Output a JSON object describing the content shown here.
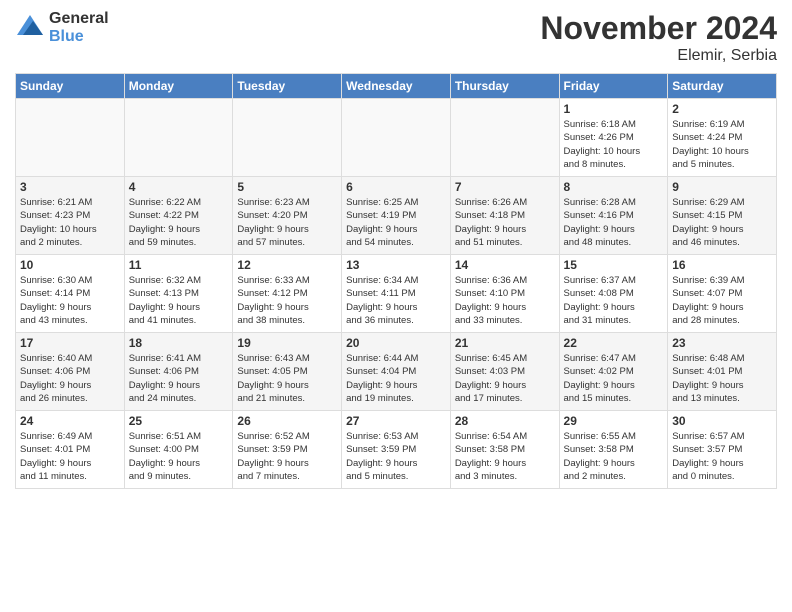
{
  "header": {
    "logo_general": "General",
    "logo_blue": "Blue",
    "month_title": "November 2024",
    "location": "Elemir, Serbia"
  },
  "weekdays": [
    "Sunday",
    "Monday",
    "Tuesday",
    "Wednesday",
    "Thursday",
    "Friday",
    "Saturday"
  ],
  "weeks": [
    [
      {
        "day": "",
        "info": ""
      },
      {
        "day": "",
        "info": ""
      },
      {
        "day": "",
        "info": ""
      },
      {
        "day": "",
        "info": ""
      },
      {
        "day": "",
        "info": ""
      },
      {
        "day": "1",
        "info": "Sunrise: 6:18 AM\nSunset: 4:26 PM\nDaylight: 10 hours\nand 8 minutes."
      },
      {
        "day": "2",
        "info": "Sunrise: 6:19 AM\nSunset: 4:24 PM\nDaylight: 10 hours\nand 5 minutes."
      }
    ],
    [
      {
        "day": "3",
        "info": "Sunrise: 6:21 AM\nSunset: 4:23 PM\nDaylight: 10 hours\nand 2 minutes."
      },
      {
        "day": "4",
        "info": "Sunrise: 6:22 AM\nSunset: 4:22 PM\nDaylight: 9 hours\nand 59 minutes."
      },
      {
        "day": "5",
        "info": "Sunrise: 6:23 AM\nSunset: 4:20 PM\nDaylight: 9 hours\nand 57 minutes."
      },
      {
        "day": "6",
        "info": "Sunrise: 6:25 AM\nSunset: 4:19 PM\nDaylight: 9 hours\nand 54 minutes."
      },
      {
        "day": "7",
        "info": "Sunrise: 6:26 AM\nSunset: 4:18 PM\nDaylight: 9 hours\nand 51 minutes."
      },
      {
        "day": "8",
        "info": "Sunrise: 6:28 AM\nSunset: 4:16 PM\nDaylight: 9 hours\nand 48 minutes."
      },
      {
        "day": "9",
        "info": "Sunrise: 6:29 AM\nSunset: 4:15 PM\nDaylight: 9 hours\nand 46 minutes."
      }
    ],
    [
      {
        "day": "10",
        "info": "Sunrise: 6:30 AM\nSunset: 4:14 PM\nDaylight: 9 hours\nand 43 minutes."
      },
      {
        "day": "11",
        "info": "Sunrise: 6:32 AM\nSunset: 4:13 PM\nDaylight: 9 hours\nand 41 minutes."
      },
      {
        "day": "12",
        "info": "Sunrise: 6:33 AM\nSunset: 4:12 PM\nDaylight: 9 hours\nand 38 minutes."
      },
      {
        "day": "13",
        "info": "Sunrise: 6:34 AM\nSunset: 4:11 PM\nDaylight: 9 hours\nand 36 minutes."
      },
      {
        "day": "14",
        "info": "Sunrise: 6:36 AM\nSunset: 4:10 PM\nDaylight: 9 hours\nand 33 minutes."
      },
      {
        "day": "15",
        "info": "Sunrise: 6:37 AM\nSunset: 4:08 PM\nDaylight: 9 hours\nand 31 minutes."
      },
      {
        "day": "16",
        "info": "Sunrise: 6:39 AM\nSunset: 4:07 PM\nDaylight: 9 hours\nand 28 minutes."
      }
    ],
    [
      {
        "day": "17",
        "info": "Sunrise: 6:40 AM\nSunset: 4:06 PM\nDaylight: 9 hours\nand 26 minutes."
      },
      {
        "day": "18",
        "info": "Sunrise: 6:41 AM\nSunset: 4:06 PM\nDaylight: 9 hours\nand 24 minutes."
      },
      {
        "day": "19",
        "info": "Sunrise: 6:43 AM\nSunset: 4:05 PM\nDaylight: 9 hours\nand 21 minutes."
      },
      {
        "day": "20",
        "info": "Sunrise: 6:44 AM\nSunset: 4:04 PM\nDaylight: 9 hours\nand 19 minutes."
      },
      {
        "day": "21",
        "info": "Sunrise: 6:45 AM\nSunset: 4:03 PM\nDaylight: 9 hours\nand 17 minutes."
      },
      {
        "day": "22",
        "info": "Sunrise: 6:47 AM\nSunset: 4:02 PM\nDaylight: 9 hours\nand 15 minutes."
      },
      {
        "day": "23",
        "info": "Sunrise: 6:48 AM\nSunset: 4:01 PM\nDaylight: 9 hours\nand 13 minutes."
      }
    ],
    [
      {
        "day": "24",
        "info": "Sunrise: 6:49 AM\nSunset: 4:01 PM\nDaylight: 9 hours\nand 11 minutes."
      },
      {
        "day": "25",
        "info": "Sunrise: 6:51 AM\nSunset: 4:00 PM\nDaylight: 9 hours\nand 9 minutes."
      },
      {
        "day": "26",
        "info": "Sunrise: 6:52 AM\nSunset: 3:59 PM\nDaylight: 9 hours\nand 7 minutes."
      },
      {
        "day": "27",
        "info": "Sunrise: 6:53 AM\nSunset: 3:59 PM\nDaylight: 9 hours\nand 5 minutes."
      },
      {
        "day": "28",
        "info": "Sunrise: 6:54 AM\nSunset: 3:58 PM\nDaylight: 9 hours\nand 3 minutes."
      },
      {
        "day": "29",
        "info": "Sunrise: 6:55 AM\nSunset: 3:58 PM\nDaylight: 9 hours\nand 2 minutes."
      },
      {
        "day": "30",
        "info": "Sunrise: 6:57 AM\nSunset: 3:57 PM\nDaylight: 9 hours\nand 0 minutes."
      }
    ]
  ]
}
